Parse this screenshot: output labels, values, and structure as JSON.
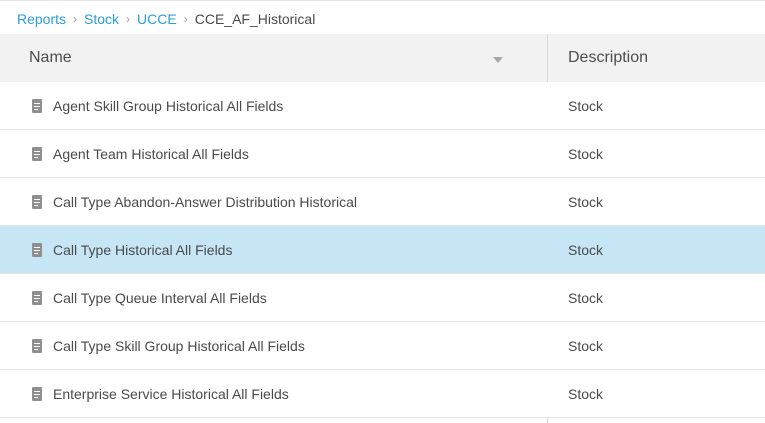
{
  "breadcrumb": {
    "items": [
      "Reports",
      "Stock",
      "UCCE"
    ],
    "current": "CCE_AF_Historical"
  },
  "table": {
    "columns": {
      "name": "Name",
      "description": "Description"
    },
    "rows": [
      {
        "name": "Agent Skill Group Historical All Fields",
        "description": "Stock",
        "selected": false
      },
      {
        "name": "Agent Team Historical All Fields",
        "description": "Stock",
        "selected": false
      },
      {
        "name": "Call Type Abandon-Answer Distribution Historical",
        "description": "Stock",
        "selected": false
      },
      {
        "name": "Call Type Historical All Fields",
        "description": "Stock",
        "selected": true
      },
      {
        "name": "Call Type Queue Interval All Fields",
        "description": "Stock",
        "selected": false
      },
      {
        "name": "Call Type Skill Group Historical All Fields",
        "description": "Stock",
        "selected": false
      },
      {
        "name": "Enterprise Service Historical All Fields",
        "description": "Stock",
        "selected": false
      }
    ]
  },
  "colors": {
    "link": "#2a9ed8",
    "selected_row": "#c6e6f6",
    "header_bg": "#f2f2f2"
  }
}
